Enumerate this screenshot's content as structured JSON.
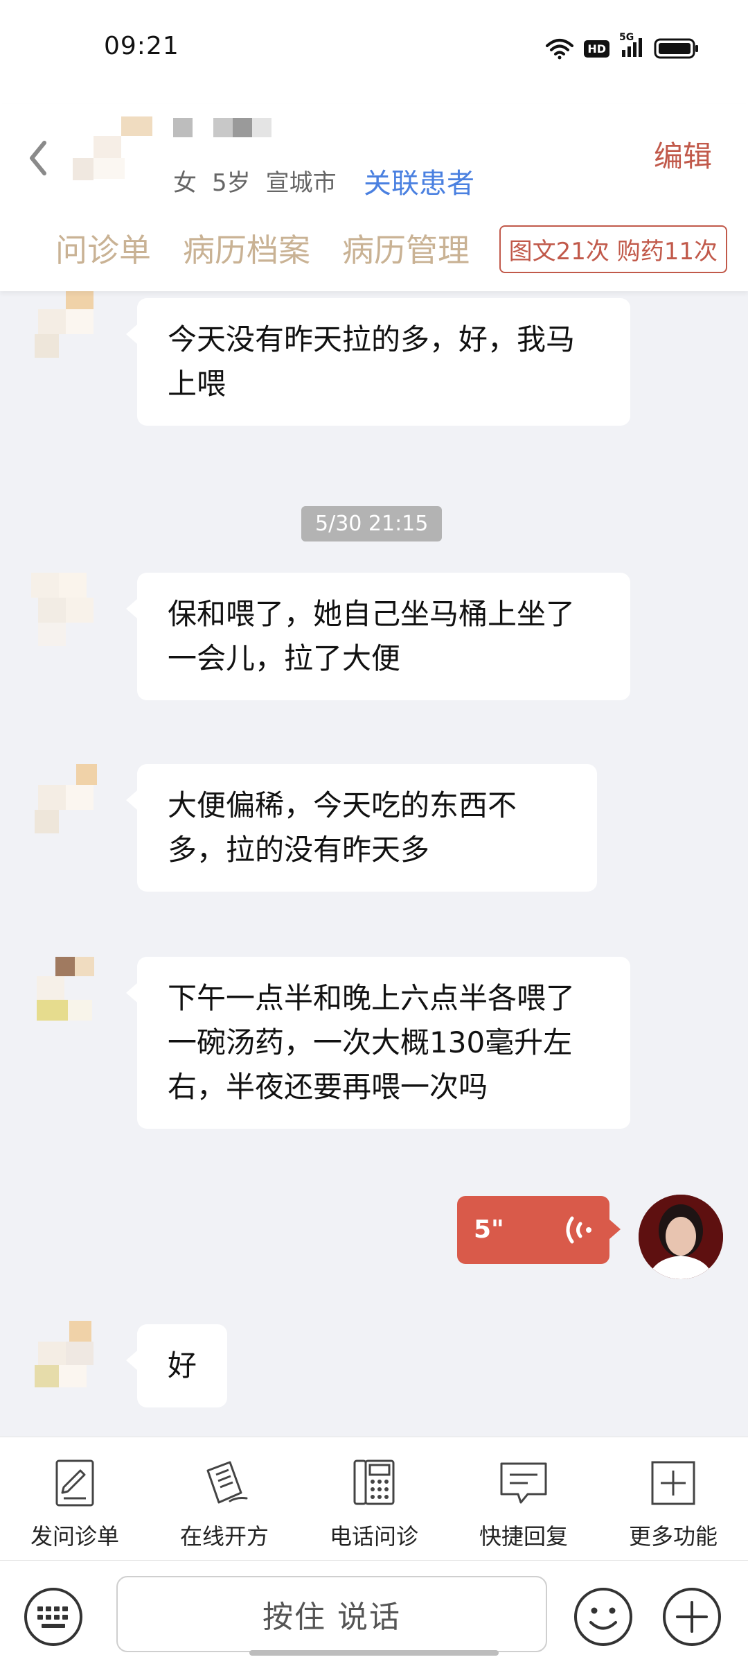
{
  "status_bar": {
    "time": "09:21",
    "hd_label": "HD",
    "network_label": "5G",
    "icons": [
      "wifi-icon",
      "hd-icon",
      "signal-icon",
      "battery-icon"
    ]
  },
  "header": {
    "gender": "女",
    "age": "5岁",
    "city": "宣城市",
    "link_patient_label": "关联患者",
    "edit_label": "编辑",
    "tabs": [
      {
        "label": "问诊单"
      },
      {
        "label": "病历档案"
      },
      {
        "label": "病历管理"
      }
    ],
    "stats_label": "图文21次 购药11次"
  },
  "messages": [
    {
      "sender": "patient",
      "text": "今天没有昨天拉的多，好，我马上喂"
    },
    {
      "sender": "patient",
      "text": "保和喂了，她自己坐马桶上坐了一会儿，拉了大便"
    },
    {
      "sender": "patient",
      "text": "大便偏稀，今天吃的东西不多，拉的没有昨天多"
    },
    {
      "sender": "patient",
      "text": "下午一点半和晚上六点半各喂了一碗汤药，一次大概130毫升左右，半夜还要再喂一次吗"
    },
    {
      "sender": "doctor",
      "type": "voice",
      "duration": "5\""
    },
    {
      "sender": "patient",
      "text": "好"
    }
  ],
  "timestamp": "5/30 21:15",
  "toolbar": {
    "items": [
      {
        "label": "发问诊单",
        "icon": "form-edit-icon"
      },
      {
        "label": "在线开方",
        "icon": "prescription-icon"
      },
      {
        "label": "电话问诊",
        "icon": "phone-icon"
      },
      {
        "label": "快捷回复",
        "icon": "quick-reply-icon"
      },
      {
        "label": "更多功能",
        "icon": "more-icon"
      }
    ]
  },
  "input_bar": {
    "hold_to_talk": "按住 说话"
  },
  "colors": {
    "accent_red": "#d95a4a",
    "link_blue": "#4a80e0",
    "tab_tan": "#c9b294",
    "background": "#f1f2f6"
  }
}
